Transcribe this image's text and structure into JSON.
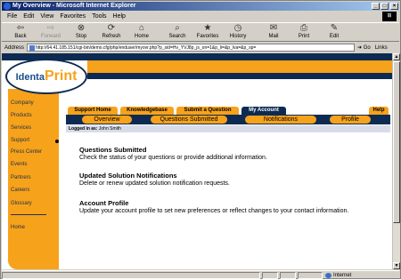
{
  "window": {
    "title": "My Overview - Microsoft Internet Explorer",
    "controls": {
      "minimize": "_",
      "maximize": "□",
      "close": "×"
    }
  },
  "menu": [
    "File",
    "Edit",
    "View",
    "Favorites",
    "Tools",
    "Help"
  ],
  "toolbar": {
    "back": "Back",
    "forward": "Forward",
    "stop": "Stop",
    "refresh": "Refresh",
    "home": "Home",
    "search": "Search",
    "favorites": "Favorites",
    "history": "History",
    "mail": "Mail",
    "print": "Print",
    "edit": "Edit"
  },
  "address": {
    "label": "Address",
    "url": "http://64.41.185.151/cgi-bin/demo.cfg/php/enduser/myovr.php?p_sid=Hv_YVJ8p_js_on=1&p_li=&p_lva=&p_sp=",
    "go": "Go",
    "links": "Links"
  },
  "logo": {
    "part1": "Identa",
    "part2": "Print"
  },
  "sidebar": [
    "Company",
    "Products",
    "Services",
    "Support",
    "Press Center",
    "Events",
    "Partners",
    "Careers",
    "Glossary",
    "Home"
  ],
  "tabs": [
    "Support Home",
    "Knowledgebase",
    "Submit a Question",
    "My Account",
    "Help"
  ],
  "subtabs": [
    "Overview",
    "Questions Submitted",
    "Notifications",
    "Profile"
  ],
  "logged_in": {
    "label": "Logged in as:",
    "user": "John Smith"
  },
  "sections": [
    {
      "title": "Questions Submitted",
      "text": "Check the status of your questions or provide additional information."
    },
    {
      "title": "Updated Solution Notifications",
      "text": "Delete or renew updated solution notification requests."
    },
    {
      "title": "Account Profile",
      "text": "Update your account profile to set new preferences or reflect changes to your contact information."
    }
  ],
  "status": {
    "zone": "Internet"
  }
}
